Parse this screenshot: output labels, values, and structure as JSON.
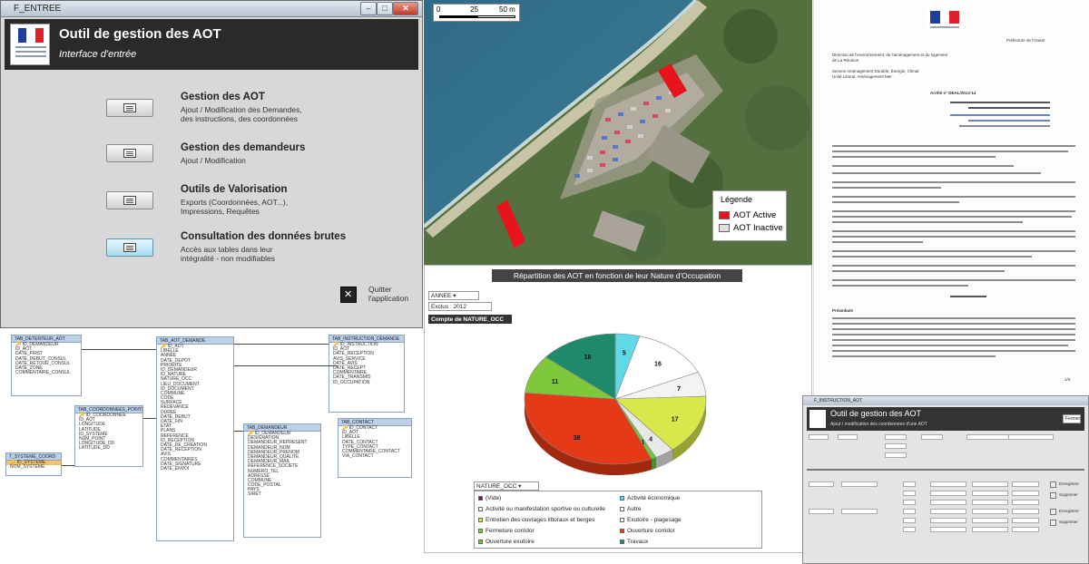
{
  "entry_window": {
    "title": "F_ENTREE",
    "app_title": "Outil de gestion des AOT",
    "app_subtitle": "Interface d'entrée",
    "menu": [
      {
        "title": "Gestion des AOT",
        "desc1": "Ajout / Modification des Demandes,",
        "desc2": "des instructions, des coordonnées"
      },
      {
        "title": "Gestion des demandeurs",
        "desc1": "Ajout / Modification",
        "desc2": ""
      },
      {
        "title": "Outils de Valorisation",
        "desc1": "Exports (Coordonnées, AOT...),",
        "desc2": "Impressions, Requêtes"
      },
      {
        "title": "Consultation des données brutes",
        "desc1": "Accès aux tables dans leur",
        "desc2": "intégralité - non modifiables"
      }
    ],
    "quit_label1": "Quitter",
    "quit_label2": "l'application"
  },
  "relationships": {
    "tables": [
      {
        "title": "TAB_DETENTEUR_AOT",
        "fields": [
          "ID_DEMANDEUR",
          "ID_AOT",
          "DATE_FIRST",
          "DATE_DEBUT_CONSUL",
          "DATE_RETOUR_CONSUL",
          "DATE_ZONE",
          "COMMENTAIRE_CONSUL"
        ]
      },
      {
        "title": "TAB_COORDONNEES_POINTS",
        "fields": [
          "ID_COORDONNEE",
          "ID_AOT",
          "LONGITUDE",
          "LATITUDE",
          "ID_SYSTEME",
          "NUM_POINT",
          "LONGITUDE_DD",
          "LATITUDE_DD"
        ]
      },
      {
        "title": "T_SYSTEME_COORD",
        "fields": [
          "ID_SYSTEME",
          "NOM_SYSTEME"
        ]
      },
      {
        "title": "TAB_AOT_DEMANDE",
        "fields": [
          "ID_AOT",
          "LIBELLE",
          "ANNEE",
          "DATE_DEPOT",
          "PRIORITE",
          "ID_DEMANDEUR",
          "ID_NATURE",
          "NATURE_OCC",
          "LIEU_DOCUMENT",
          "ID_DOCUMENT",
          "COMMUNE",
          "CODE",
          "SURFACE",
          "REDEVANCE",
          "DUREE",
          "DATE_DEBUT",
          "DATE_FIN",
          "ETAT",
          "PLANS",
          "REFERENCE",
          "ID_RECEPTION",
          "DATE_DE_CREATION",
          "DATE_RECEPTION",
          "AVIS",
          "COMMENTAIRES",
          "DATE_SIGNATURE",
          "DATE_ENVOI"
        ]
      },
      {
        "title": "TAB_INSTRUCTION_DEMANDE",
        "fields": [
          "ID_INSTRUCTION",
          "ID_AOT",
          "DATE_RECEPTION",
          "AVIS_SERVICE",
          "DATE_AVIS",
          "DATE_RECEPT",
          "COMMENTAIRE",
          "DATE_TRANSMIS",
          "ID_OCCUPATION"
        ]
      },
      {
        "title": "TAB_DEMANDEUR",
        "fields": [
          "ID_DEMANDEUR",
          "DESIGNATION",
          "DEMANDEUR_REPRESENT",
          "DEMANDEUR_NOM",
          "DEMANDEUR_PRENOM",
          "DEMANDEUR_QUALITE",
          "DEMANDEUR_MAIL",
          "REFERENCE_SOCIETE",
          "NUMERO_TEL",
          "ADRESSE",
          "COMMUNE",
          "CODE_POSTAL",
          "PAYS",
          "SIRET"
        ]
      },
      {
        "title": "TAB_CONTACT",
        "fields": [
          "ID_CONTACT",
          "ID_AOT",
          "LIBELLE",
          "DATE_CONTACT",
          "TYPE_CONTACT",
          "COMMENTAIRE_CONTACT",
          "VIA_CONTACT"
        ]
      }
    ]
  },
  "map": {
    "scale_labels": [
      "0",
      "25",
      "50 m"
    ],
    "legend_title": "Légende",
    "legend_items": [
      {
        "label": "AOT Active",
        "color": "#e8141c"
      },
      {
        "label": "AOT Inactive",
        "color": "#e0e0e0"
      }
    ]
  },
  "chart_panel": {
    "title": "Répartition des AOT en fonction de leur Nature d'Occupation",
    "filter_field": "ANNEE",
    "filter_value": "Exclus : 2012",
    "measure_label": "Compte de NATURE_OCC",
    "legend_header": "NATURE_OCC",
    "legend_items": [
      {
        "label": "(Vide)",
        "color": "#5b2a5b"
      },
      {
        "label": "Activité économique",
        "color": "#5fd8e8"
      },
      {
        "label": "Activité ou manifestation sportive ou culturelle",
        "color": "#ffffff"
      },
      {
        "label": "Autre",
        "color": "#ffffff"
      },
      {
        "label": "Entretien des ouvrages littoraux et berges",
        "color": "#d8e84a"
      },
      {
        "label": "Exutoire - plagesage",
        "color": "#ffffff"
      },
      {
        "label": "Fermeture corridor",
        "color": "#7fc83a"
      },
      {
        "label": "Ouverture corridor",
        "color": "#e43a17"
      },
      {
        "label": "Ouverture exutoire",
        "color": "#6cc83a"
      },
      {
        "label": "Travaux",
        "color": "#1f8a6a"
      }
    ]
  },
  "chart_data": {
    "type": "pie",
    "title": "Répartition des AOT en fonction de leur Nature d'Occupation",
    "slices": [
      {
        "label": "Activité économique",
        "value": 5,
        "color": "#5fd8e8"
      },
      {
        "label": "Autre",
        "value": 16,
        "color": "#ffffff"
      },
      {
        "label": "Exutoire - plagesage",
        "value": 7,
        "color": "#f3f3f3"
      },
      {
        "label": "Entretien des ouvrages littoraux et berges",
        "value": 17,
        "color": "#d8e84a"
      },
      {
        "label": "Activité ou manifestation sportive ou culturelle",
        "value": 4,
        "color": "#e8e8e8"
      },
      {
        "label": "Ouverture exutoire",
        "value": 1,
        "color": "#6cc83a"
      },
      {
        "label": "Ouverture corridor",
        "value": 38,
        "color": "#e43a17"
      },
      {
        "label": "Fermeture corridor",
        "value": 11,
        "color": "#7fc83a"
      },
      {
        "label": "Travaux",
        "value": 16,
        "color": "#1f8a6a"
      }
    ],
    "legend_placement": "bottom"
  },
  "document": {
    "header_right": "Préfecture de l'Ouest",
    "lines": [
      "Direction de l'environnement, de l'aménagement et du logement",
      "de La Réunion",
      "Service Aménagement Durable, Énergie, Climat",
      "Unité Littoral, Aménagement Mer"
    ],
    "title": "Arrêté n° DEAL/2013-14",
    "paragraph_title": "Préambule",
    "page_num": "1/3"
  },
  "form_window": {
    "titlebar": "F_INSTRUCTION_AOT",
    "app_title": "Outil de gestion des AOT",
    "subtitle": "Ajout / modification des coordonnées d'une AOT",
    "button_label": "Fermer",
    "side_labels": [
      "Enregistrer",
      "Supprimer",
      "Enregistrer",
      "Supprimer"
    ]
  }
}
